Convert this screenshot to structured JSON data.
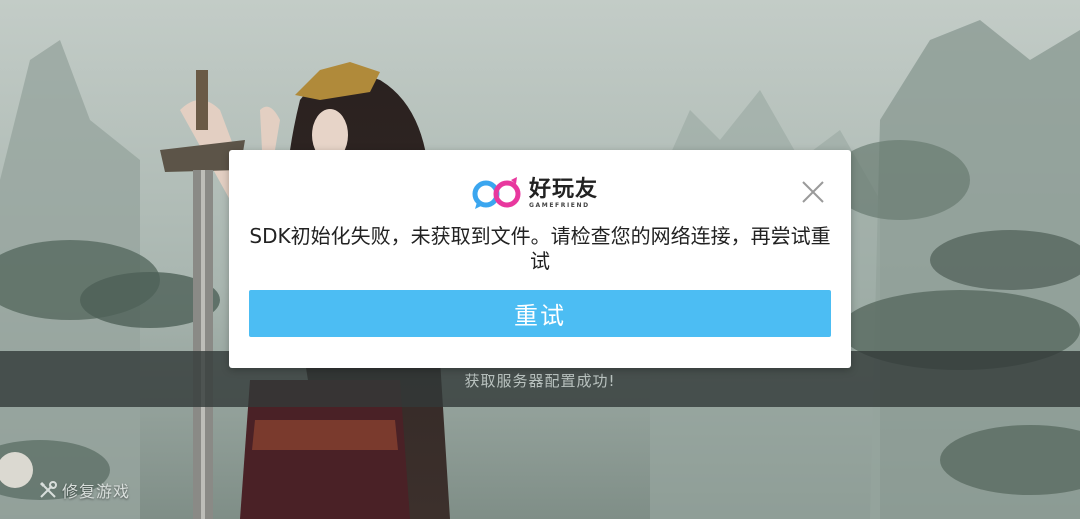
{
  "dialog": {
    "logo_text": "好玩友",
    "logo_subtext": "GAMEFRIEND",
    "message": "SDK初始化失败，未获取到文件。请检查您的网络连接，再尝试重试",
    "retry_label": "重试",
    "close_icon": "close-icon",
    "accent_color": "#4cbdf3"
  },
  "status": {
    "text": "获取服务器配置成功!"
  },
  "footer": {
    "repair_label": "修复游戏",
    "repair_icon": "wrench-screwdriver-icon"
  }
}
